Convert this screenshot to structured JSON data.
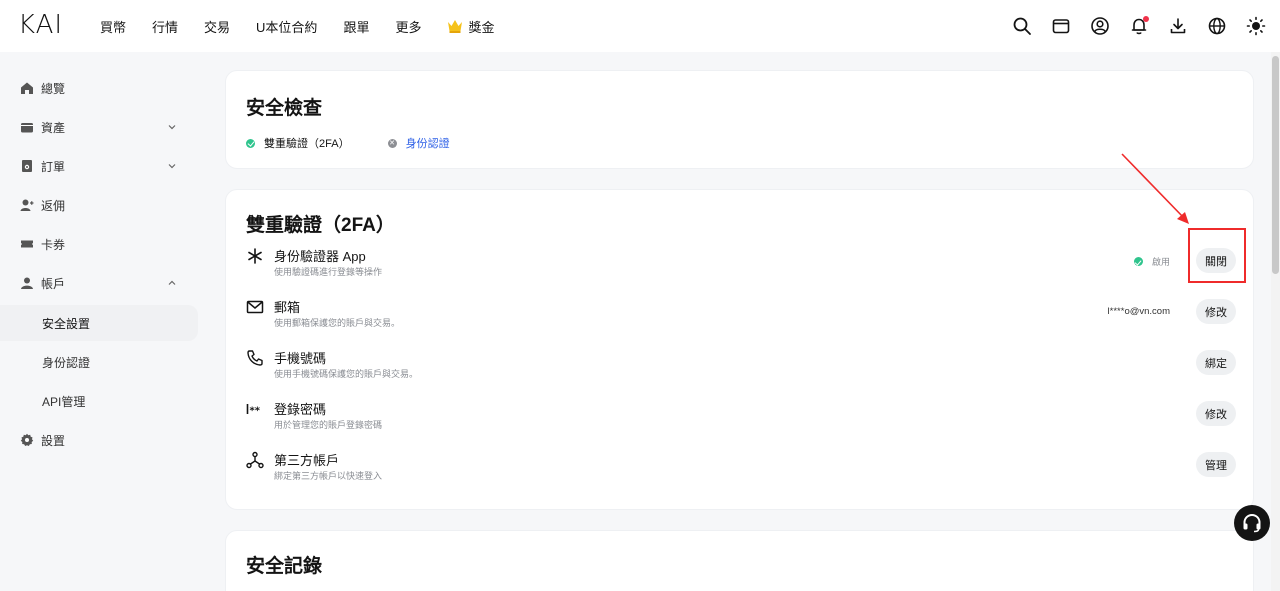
{
  "brand": {
    "logo": "KAI"
  },
  "nav": {
    "items": [
      "買幣",
      "行情",
      "交易",
      "U本位合約",
      "跟單",
      "更多"
    ],
    "reward": "獎金",
    "icons": [
      "search-icon",
      "wallet-icon",
      "user-icon",
      "bell-icon",
      "download-icon",
      "globe-icon",
      "sun-icon"
    ]
  },
  "sidebar": {
    "items": [
      {
        "label": "總覽",
        "icon": "home-icon"
      },
      {
        "label": "資產",
        "icon": "wallet-icon"
      },
      {
        "label": "訂單",
        "icon": "order-icon"
      },
      {
        "label": "返佣",
        "icon": "referral-icon"
      },
      {
        "label": "卡券",
        "icon": "ticket-icon"
      },
      {
        "label": "帳戶",
        "icon": "account-icon"
      },
      {
        "label": "安全設置"
      },
      {
        "label": "身份認證"
      },
      {
        "label": "API管理"
      },
      {
        "label": "設置",
        "icon": "gear-icon"
      }
    ]
  },
  "security_check": {
    "title": "安全檢查",
    "items": [
      {
        "label": "雙重驗證（2FA）",
        "status": "ok"
      },
      {
        "label": "身份認證",
        "status": "missing"
      }
    ]
  },
  "two_fa": {
    "title": "雙重驗證（2FA）",
    "rows": [
      {
        "title": "身份驗證器 App",
        "desc": "使用驗證碼進行登錄等操作",
        "status": "啟用",
        "button": "關閉",
        "icon": "asterisk-icon"
      },
      {
        "title": "郵箱",
        "desc": "使用郵箱保護您的賬戶與交易。",
        "value": "l****o@vn.com",
        "button": "修改",
        "icon": "mail-icon"
      },
      {
        "title": "手機號碼",
        "desc": "使用手機號碼保護您的賬戶與交易。",
        "button": "綁定",
        "icon": "phone-icon"
      },
      {
        "title": "登錄密碼",
        "desc": "用於管理您的賬戶登錄密碼",
        "button": "修改",
        "icon": "password-icon"
      },
      {
        "title": "第三方帳戶",
        "desc": "綁定第三方帳戶以快速登入",
        "button": "管理",
        "icon": "share-icon"
      }
    ]
  },
  "security_log": {
    "title": "安全記錄"
  },
  "colors": {
    "accent_link": "#2b5ee6",
    "success": "#2fc48d",
    "highlight": "#ef2b2b"
  }
}
